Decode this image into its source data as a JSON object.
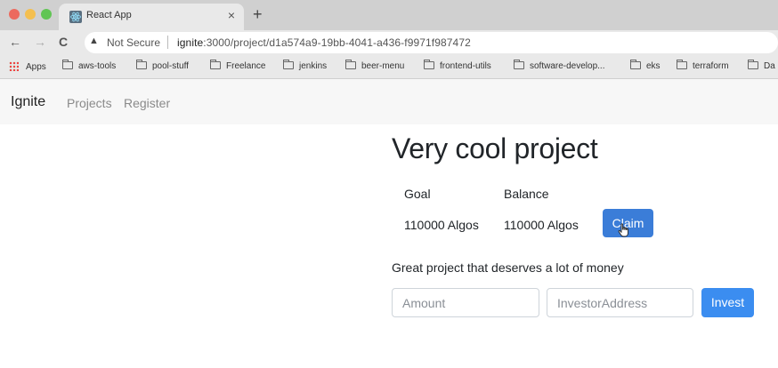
{
  "browser": {
    "tab_title": "React App",
    "tab_close": "×",
    "new_tab": "+",
    "back": "←",
    "forward": "→",
    "reload": "C",
    "security_icon": "▲",
    "security_label": "Not Secure",
    "url_host": "ignite",
    "url_rest": ":3000/project/d1a574a9-19bb-4041-a436-f9971f987472",
    "bookmarks": [
      "Apps",
      "aws-tools",
      "pool-stuff",
      "Freelance",
      "jenkins",
      "beer-menu",
      "frontend-utils",
      "software-develop...",
      "eks",
      "terraform",
      "Da"
    ]
  },
  "navbar": {
    "brand": "Ignite",
    "links": [
      "Projects",
      "Register"
    ]
  },
  "project": {
    "title": "Very cool project",
    "goal_label": "Goal",
    "balance_label": "Balance",
    "goal_value": "110000 Algos",
    "balance_value": "110000 Algos",
    "claim_label": "Claim",
    "description": "Great project that deserves a lot of money"
  },
  "invest_form": {
    "amount_placeholder": "Amount",
    "address_placeholder": "InvestorAddress",
    "invest_label": "Invest"
  },
  "colors": {
    "primary": "#3b7dd8",
    "navbar_bg": "#f7f7f7"
  }
}
